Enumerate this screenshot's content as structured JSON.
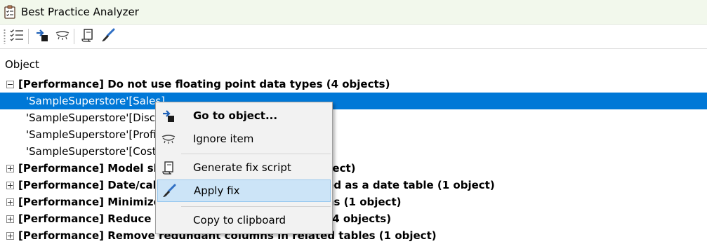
{
  "window": {
    "title": "Best Practice Analyzer"
  },
  "toolbar": {
    "buttons": [
      {
        "icon": "checklist-icon"
      },
      {
        "icon": "go-to-object-icon"
      },
      {
        "icon": "ignore-eye-icon"
      },
      {
        "icon": "script-icon"
      },
      {
        "icon": "brush-icon"
      }
    ]
  },
  "list": {
    "column_header": "Object",
    "rows": [
      {
        "kind": "rule",
        "expanded": true,
        "text": "[Performance] Do not use floating point data types (4 objects)"
      },
      {
        "kind": "object",
        "selected": true,
        "text": "'SampleSuperstore'[Sales]"
      },
      {
        "kind": "object",
        "text": "'SampleSuperstore'[Discount]"
      },
      {
        "kind": "object",
        "text": "'SampleSuperstore'[Profit]"
      },
      {
        "kind": "object",
        "text": "'SampleSuperstore'[Cost]"
      },
      {
        "kind": "rule",
        "expanded": false,
        "text": "[Performance] Model should have a date table (1 object)"
      },
      {
        "kind": "rule",
        "expanded": false,
        "text": "[Performance] Date/calendar tables should be marked as a date table (1 object)"
      },
      {
        "kind": "rule",
        "expanded": false,
        "text": "[Performance] Minimize Power Query transformations (1 object)"
      },
      {
        "kind": "rule",
        "expanded": false,
        "text": "[Performance] Reduce usage of calculated columns (4 objects)"
      },
      {
        "kind": "rule",
        "expanded": false,
        "text": "[Performance] Remove redundant columns in related tables (1 object)"
      }
    ]
  },
  "context_menu": {
    "items": [
      {
        "label": "Go to object...",
        "icon": "go-to-object-icon",
        "bold": true
      },
      {
        "label": "Ignore item",
        "icon": "ignore-eye-icon"
      },
      {
        "label": "Generate fix script",
        "icon": "script-icon"
      },
      {
        "label": "Apply fix",
        "icon": "brush-icon",
        "hovered": true
      },
      {
        "label": "Copy to clipboard"
      }
    ]
  },
  "colors": {
    "selection": "#0078d7",
    "menu_hover": "#cce4f7",
    "title_bar": "#f2f8ec"
  }
}
